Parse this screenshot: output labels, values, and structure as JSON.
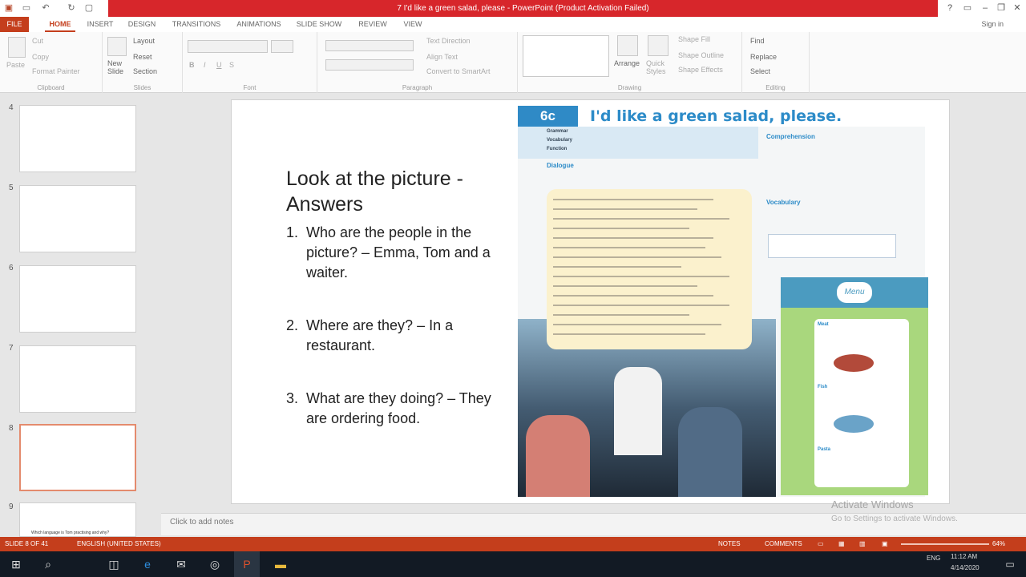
{
  "window": {
    "title": "7 I'd like a green salad, please - PowerPoint (Product Activation Failed)"
  },
  "ribbon_tabs": [
    "FILE",
    "HOME",
    "INSERT",
    "DESIGN",
    "TRANSITIONS",
    "ANIMATIONS",
    "SLIDE SHOW",
    "REVIEW",
    "VIEW"
  ],
  "signin": "Sign in",
  "ribbon": {
    "clipboard": {
      "paste": "Paste",
      "cut": "Cut",
      "copy": "Copy",
      "format_painter": "Format Painter",
      "label": "Clipboard"
    },
    "slides": {
      "new_slide": "New Slide",
      "layout": "Layout",
      "reset": "Reset",
      "section": "Section",
      "label": "Slides"
    },
    "font": {
      "label": "Font"
    },
    "paragraph": {
      "text_direction": "Text Direction",
      "align_text": "Align Text",
      "convert": "Convert to SmartArt",
      "label": "Paragraph"
    },
    "drawing": {
      "arrange": "Arrange",
      "quick_styles": "Quick Styles",
      "shape_fill": "Shape Fill",
      "shape_outline": "Shape Outline",
      "shape_effects": "Shape Effects",
      "label": "Drawing"
    },
    "editing": {
      "find": "Find",
      "replace": "Replace",
      "select": "Select",
      "label": "Editing"
    }
  },
  "thumbnails": [
    {
      "num": "4"
    },
    {
      "num": "5"
    },
    {
      "num": "6"
    },
    {
      "num": "7"
    },
    {
      "num": "8",
      "selected": true
    },
    {
      "num": "9",
      "caption": "Which language is Tom practising and why?"
    }
  ],
  "slide": {
    "title_line1": "Look at the picture -",
    "title_line2": "Answers",
    "questions": [
      {
        "n": "1.",
        "text": "Who are the people in the picture? – Emma, Tom and a waiter."
      },
      {
        "n": "2.",
        "text": "Where are they? – In a restaurant."
      },
      {
        "n": "3.",
        "text": "What are they doing? – They are ordering food."
      }
    ],
    "book": {
      "badge": "6c",
      "title": "I'd like a green salad, please.",
      "grammar": "Grammar",
      "vocabulary": "Vocabulary",
      "function": "Function",
      "dialogue": "Dialogue",
      "comprehension": "Comprehension",
      "vocab_head": "Vocabulary",
      "menu": "Menu",
      "meat": "Meat",
      "fish": "Fish",
      "pasta": "Pasta"
    }
  },
  "notes_placeholder": "Click to add notes",
  "watermark": {
    "line1": "Activate Windows",
    "line2": "Go to Settings to activate Windows."
  },
  "status": {
    "slide": "SLIDE 8 OF 41",
    "language": "ENGLISH (UNITED STATES)",
    "notes": "NOTES",
    "comments": "COMMENTS",
    "zoom": "64%"
  },
  "taskbar": {
    "lang": "ENG",
    "time": "11:12 AM",
    "date": "4/14/2020"
  },
  "colors": {
    "accent": "#c43e1c",
    "titlebar": "#d7262b"
  }
}
